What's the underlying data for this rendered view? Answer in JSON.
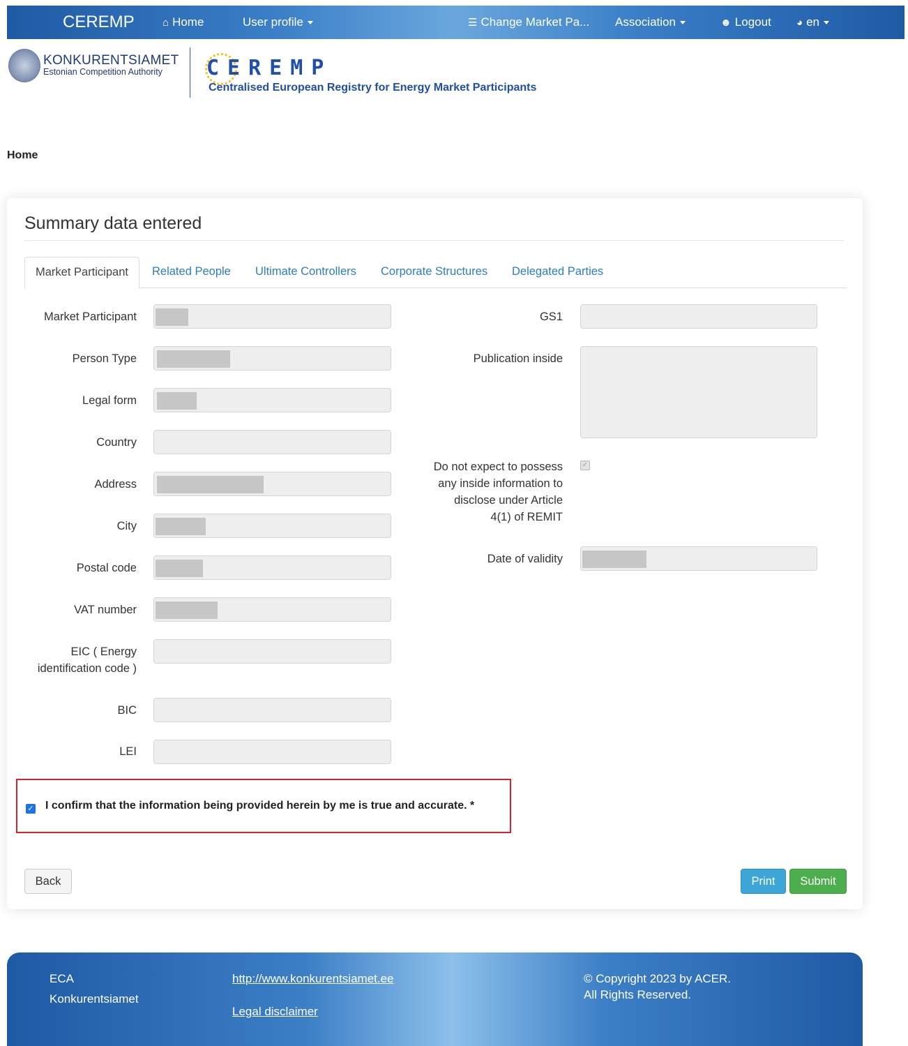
{
  "nav": {
    "brand": "CEREMP",
    "home": "Home",
    "user_profile": "User profile",
    "change_market": "Change Market Pa...",
    "association": "Association",
    "logout": "Logout",
    "language": "en"
  },
  "header": {
    "authority_name": "KONKURENTSIAMET",
    "authority_sub": "Estonian Competition Authority",
    "ceremp_logo": "CEREMP",
    "ceremp_full": "Centralised European Registry for Energy Market Participants"
  },
  "breadcrumb": "Home",
  "panel": {
    "title": "Summary data entered",
    "tabs": [
      "Market Participant",
      "Related People",
      "Ultimate Controllers",
      "Corporate Structures",
      "Delegated Parties"
    ],
    "left_fields": {
      "market_participant": "Market Participant",
      "person_type": "Person Type",
      "legal_form": "Legal form",
      "country": "Country",
      "address": "Address",
      "city": "City",
      "postal_code": "Postal code",
      "vat_number": "VAT number",
      "eic_line1": "EIC ( Energy",
      "eic_line2": "identification code )",
      "bic": "BIC",
      "lei": "LEI"
    },
    "right_fields": {
      "gs1": "GS1",
      "publication_inside": "Publication inside",
      "no_inside_line1": "Do not expect to possess",
      "no_inside_line2": "any inside information to",
      "no_inside_line3": "disclose under Article",
      "no_inside_line4": "4(1) of REMIT",
      "date_of_validity": "Date of validity"
    },
    "confirm_text": "I confirm that the information being provided herein by me is true and accurate. *",
    "buttons": {
      "back": "Back",
      "print": "Print",
      "submit": "Submit"
    }
  },
  "footer": {
    "eca": "ECA",
    "org": "Konkurentsiamet",
    "url": "http://www.konkurentsiamet.ee",
    "legal": "Legal disclaimer",
    "copyright": "© Copyright 2023 by ACER.",
    "rights": "All Rights Reserved."
  }
}
